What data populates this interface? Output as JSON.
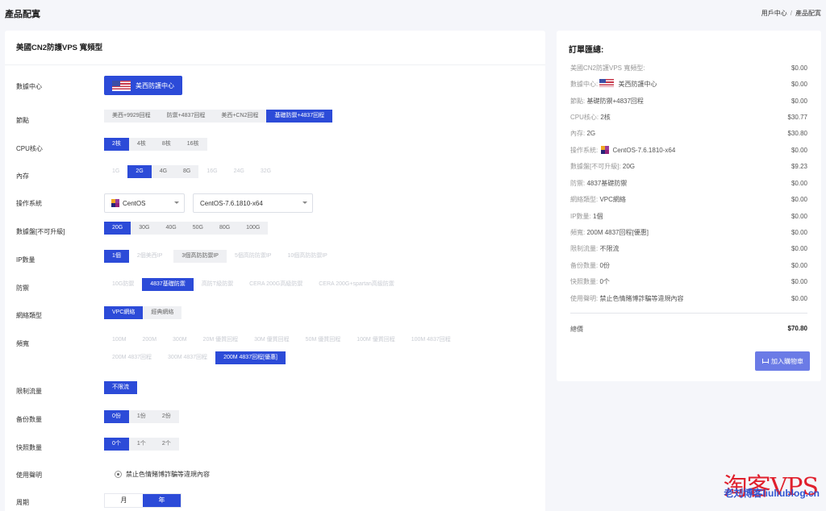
{
  "header": {
    "page_title": "產品配寘",
    "breadcrumb": [
      "用戶中心",
      "/",
      "產品配寘"
    ]
  },
  "product": {
    "title": "美國CN2防護VPS 寬頻型",
    "datacenter": {
      "label": "數據中心",
      "selected": "美西防護中心"
    },
    "node": {
      "label": "節點",
      "options": [
        "美西+9929回程",
        "防禦+4837回程",
        "美西+CN2回程",
        "基礎防禦+4837回程"
      ],
      "selected_index": 3
    },
    "cpu": {
      "label": "CPU核心",
      "options": [
        "2核",
        "4核",
        "8核",
        "16核"
      ],
      "selected_index": 0
    },
    "memory": {
      "label": "內存",
      "options": [
        "1G",
        "2G",
        "4G",
        "8G",
        "16G",
        "24G",
        "32G"
      ],
      "selected_index": 1
    },
    "os": {
      "label": "操作系統",
      "family": "CentOS",
      "version": "CentOS-7.6.1810-x64"
    },
    "disk": {
      "label": "數據盤[不可升級]",
      "options": [
        "20G",
        "30G",
        "40G",
        "50G",
        "80G",
        "100G"
      ],
      "selected_index": 0
    },
    "ip": {
      "label": "IP數量",
      "options": [
        "1個",
        "2個美西IP",
        "3個高防防禦IP",
        "5個高防防禦IP",
        "10個高防防禦IP"
      ],
      "selected_index": 0
    },
    "defense": {
      "label": "防禦",
      "options": [
        "10G防禦",
        "4837基礎防禦",
        "高防T級防禦",
        "CERA 200G高級防禦",
        "CERA 200G+spartan高級防禦"
      ],
      "selected_index": 1
    },
    "network": {
      "label": "網絡類型",
      "options": [
        "VPC網絡",
        "經典網絡"
      ],
      "selected_index": 0
    },
    "bandwidth": {
      "label": "頻寬",
      "options": [
        "100M",
        "200M",
        "300M",
        "20M 優質回程",
        "30M 優質回程",
        "50M 優質回程",
        "100M 優質回程",
        "100M 4837回程",
        "200M 4837回程",
        "300M 4837回程",
        "200M 4837回程[優惠]"
      ],
      "selected_index": 10
    },
    "traffic": {
      "label": "限制流量",
      "options": [
        "不限流"
      ],
      "selected_index": 0
    },
    "backup": {
      "label": "备份数量",
      "options": [
        "0份",
        "1份",
        "2份"
      ],
      "selected_index": 0
    },
    "snapshot": {
      "label": "快照數量",
      "options": [
        "0个",
        "1个",
        "2个"
      ],
      "selected_index": 0
    },
    "usage": {
      "label": "使用聲明",
      "value": "禁止色情賭博詐騙等違規內容"
    },
    "cycle": {
      "label": "周期",
      "options": [
        "月",
        "年"
      ],
      "selected_index": 1
    }
  },
  "summary": {
    "title": "訂單匯總:",
    "rows": [
      {
        "key": "美國CN2防護VPS 寬頻型:",
        "value": "",
        "price": "$0.00"
      },
      {
        "key": "數據中心:",
        "value": "美西防護中心",
        "icon": "us-flag-icon",
        "price": "$0.00"
      },
      {
        "key": "節點:",
        "value": "基礎防禦+4837回程",
        "price": "$0.00"
      },
      {
        "key": "CPU核心:",
        "value": "2核",
        "price": "$30.77"
      },
      {
        "key": "內存:",
        "value": "2G",
        "price": "$30.80"
      },
      {
        "key": "操作系統:",
        "value": "CentOS-7.6.1810-x64",
        "icon": "centos-icon",
        "price": "$0.00"
      },
      {
        "key": "數據盤[不可升級]:",
        "value": "20G",
        "price": "$9.23"
      },
      {
        "key": "防禦:",
        "value": "4837基礎防禦",
        "price": "$0.00"
      },
      {
        "key": "網絡類型:",
        "value": "VPC網絡",
        "price": "$0.00"
      },
      {
        "key": "IP數量:",
        "value": "1個",
        "price": "$0.00"
      },
      {
        "key": "頻寬:",
        "value": "200M 4837回程[優惠]",
        "price": "$0.00"
      },
      {
        "key": "限制流量:",
        "value": "不限流",
        "price": "$0.00"
      },
      {
        "key": "备份数量:",
        "value": "0份",
        "price": "$0.00"
      },
      {
        "key": "快照數量:",
        "value": "0个",
        "price": "$0.00"
      },
      {
        "key": "使用聲明:",
        "value": "禁止色情賭博詐騙等違規內容",
        "price": "$0.00"
      }
    ],
    "total_label": "總價",
    "total_value": "$70.80",
    "cart_button": "加入購物車"
  },
  "watermark": {
    "main": "淘客VPS",
    "sub": "老刘博客liuliublog.cn"
  },
  "colors": {
    "accent": "#2c4bd8",
    "cart_button": "#6b7be6",
    "option_bg": "#eff0f3",
    "watermark_red": "#e01f2c"
  }
}
